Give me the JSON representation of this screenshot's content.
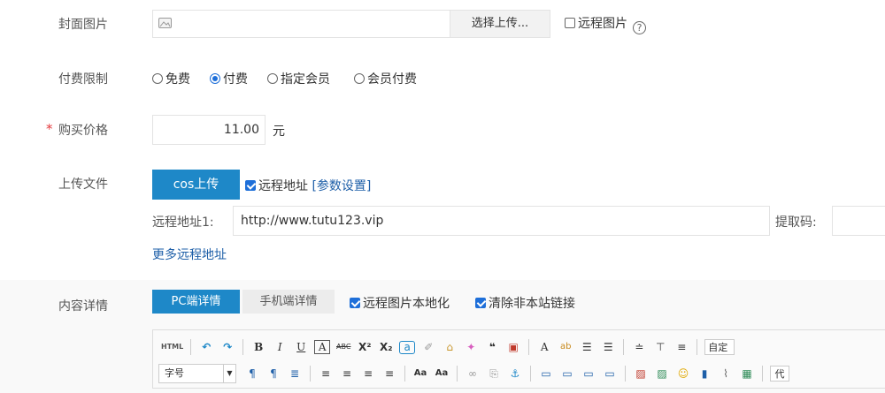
{
  "cover": {
    "label": "封面图片",
    "upload_button": "选择上传...",
    "remote_label": "远程图片",
    "help_glyph": "?"
  },
  "payment": {
    "label": "付费限制",
    "options": [
      "免费",
      "付费",
      "指定会员",
      "会员付费"
    ],
    "selected": "付费"
  },
  "price": {
    "required_mark": "*",
    "label": "购买价格",
    "value": "11.00",
    "unit": "元"
  },
  "upload": {
    "label": "上传文件",
    "cos_button": "cos上传",
    "remote_address_label": "远程地址",
    "param_settings": "[参数设置]",
    "remote1_label": "远程地址1:",
    "remote1_value": "http://www.tutu123.vip",
    "extract_label": "提取码:",
    "more_remote": "更多远程地址"
  },
  "content": {
    "label": "内容详情",
    "tab_pc": "PC端详情",
    "tab_mobile": "手机端详情",
    "localize_remote_images": "远程图片本地化",
    "clear_external_links": "清除非本站链接"
  },
  "editor": {
    "row1": [
      "HTML",
      "↶",
      "↷",
      "B",
      "I",
      "U",
      "A",
      "ABC",
      "X²",
      "X₂",
      "a",
      "✐",
      "⌂",
      "✦",
      "❝",
      "▣",
      "A",
      "ab",
      "☰",
      "☰",
      "≐",
      "⊤",
      "≡"
    ],
    "custom_label": "自定",
    "font_size_label": "字号",
    "row2": [
      "¶",
      "¶",
      "≣",
      "≡",
      "≡",
      "≡",
      "≡",
      "Aa",
      "Aa",
      "∞",
      "⎘",
      "⚓",
      "▭",
      "▭",
      "▭",
      "▭",
      "▨",
      "▨",
      "☺",
      "▮",
      "⌇",
      "▦"
    ],
    "code_label": "代"
  },
  "colors": {
    "accent": "#1e88c8",
    "checkbox": "#1e6fd9",
    "required": "#e4393c",
    "link": "#1e5fa8"
  }
}
